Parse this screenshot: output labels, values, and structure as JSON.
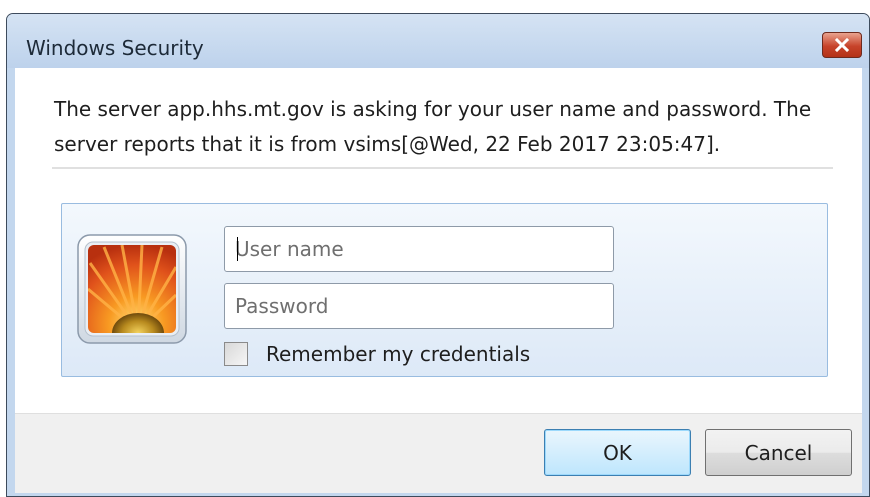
{
  "window": {
    "title": "Windows Security",
    "close_icon": "close-icon"
  },
  "message": {
    "line1": "The server app.hhs.mt.gov is asking for your user name and password. The",
    "line2": "server reports that it is from vsims[@Wed, 22 Feb 2017 23:05:47]."
  },
  "credentials": {
    "user_tile_icon": "user-tile-flower-icon",
    "username": {
      "value": "",
      "placeholder": "User name"
    },
    "password": {
      "value": "",
      "placeholder": "Password"
    },
    "remember": {
      "label": "Remember my credentials",
      "checked": false
    }
  },
  "buttons": {
    "ok_label": "OK",
    "cancel_label": "Cancel"
  },
  "colors": {
    "title_bar": "#c3d7ee",
    "close_button": "#c7432a",
    "panel_border": "#99bce0",
    "ok_focus": "#3c7fb1"
  }
}
